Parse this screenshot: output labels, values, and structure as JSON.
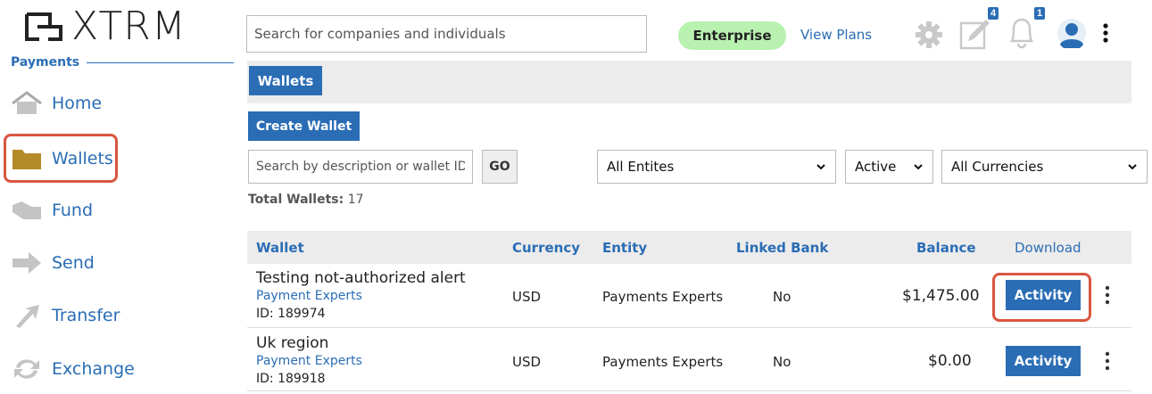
{
  "brand": {
    "name": "XTRM"
  },
  "sidebar": {
    "section": "Payments",
    "items": [
      {
        "label": "Home",
        "icon": "home-icon"
      },
      {
        "label": "Wallets",
        "icon": "folder-icon"
      },
      {
        "label": "Fund",
        "icon": "fund-icon"
      },
      {
        "label": "Send",
        "icon": "send-arrow-icon"
      },
      {
        "label": "Transfer",
        "icon": "transfer-icon"
      },
      {
        "label": "Exchange",
        "icon": "exchange-icon"
      }
    ]
  },
  "topbar": {
    "search_placeholder": "Search for companies and individuals",
    "plan": "Enterprise",
    "view_plans": "View Plans",
    "tasks_count": "4",
    "notifications_count": "1"
  },
  "tabs": [
    {
      "label": "Wallets"
    }
  ],
  "actions": {
    "create_wallet": "Create Wallet"
  },
  "filters": {
    "search_placeholder": "Search by description or wallet ID",
    "go": "GO",
    "entity": "All Entites",
    "status": "Active",
    "currency": "All Currencies"
  },
  "summary": {
    "total_label": "Total Wallets:",
    "total_value": "17"
  },
  "table": {
    "columns": [
      "Wallet",
      "Currency",
      "Entity",
      "Linked Bank",
      "Balance",
      "Download"
    ],
    "rows": [
      {
        "name": "Testing not-authorized alert",
        "company": "Payment Experts",
        "id": "ID: 189974",
        "currency": "USD",
        "entity": "Payments Experts",
        "linked_bank": "No",
        "balance": "$1,475.00",
        "action": "Activity"
      },
      {
        "name": "Uk region",
        "company": "Payment Experts",
        "id": "ID: 189918",
        "currency": "USD",
        "entity": "Payments Experts",
        "linked_bank": "No",
        "balance": "$0.00",
        "action": "Activity"
      }
    ]
  },
  "colors": {
    "accent": "#2a6db5",
    "highlight": "#d9553f",
    "plan_badge": "#b9f1b1",
    "folder": "#b58b2a"
  }
}
